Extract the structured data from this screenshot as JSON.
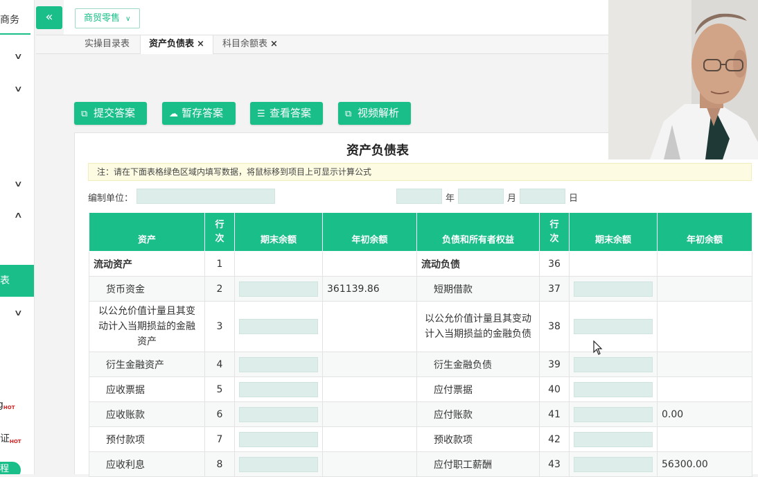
{
  "sidebar": {
    "brand": "商务",
    "active_item": "表",
    "hot_items": [
      {
        "label": "g",
        "badge": "HOT"
      },
      {
        "label": "证",
        "badge": "HOT"
      }
    ],
    "bottom_pill": "程"
  },
  "topbar": {
    "collapse_icon": "«",
    "store_select": "商贸零售"
  },
  "tabs": [
    {
      "label": "实操目录表",
      "active": false,
      "closable": false
    },
    {
      "label": "资产负债表",
      "active": true,
      "closable": true
    },
    {
      "label": "科目余额表",
      "active": false,
      "closable": true
    }
  ],
  "tab_close_icon": "×",
  "actions": [
    {
      "label": "提交答案",
      "icon": "external-link-icon"
    },
    {
      "label": "暂存答案",
      "icon": "cloud-upload-icon"
    },
    {
      "label": "查看答案",
      "icon": "database-icon"
    },
    {
      "label": "视频解析",
      "icon": "external-link-icon"
    }
  ],
  "sheet": {
    "title": "资产负债表",
    "notice": "注：请在下面表格绿色区域内填写数据，将鼠标移到项目上可显示计算公式",
    "unit_label": "编制单位：",
    "date_labels": {
      "year": "年",
      "month": "月",
      "day": "日"
    }
  },
  "table": {
    "headers": [
      "资产",
      "行次",
      "期末余额",
      "年初余额",
      "负债和所有者权益",
      "行次",
      "期末余额",
      "年初余额"
    ],
    "rows": [
      {
        "asset": "流动资产",
        "asset_no": "1",
        "asset_end": "",
        "asset_begin": "",
        "liab": "流动负债",
        "liab_no": "36",
        "liab_end": "",
        "liab_begin": ""
      },
      {
        "asset": "货币资金",
        "asset_no": "2",
        "asset_end": "",
        "asset_begin": "361139.86",
        "liab": "短期借款",
        "liab_no": "37",
        "liab_end": "",
        "liab_begin": ""
      },
      {
        "asset": "以公允价值计量且其变动计入当期损益的金融资产",
        "asset_no": "3",
        "asset_end": "",
        "asset_begin": "",
        "liab": "以公允价值计量且其变动计入当期损益的金融负债",
        "liab_no": "38",
        "liab_end": "",
        "liab_begin": ""
      },
      {
        "asset": "衍生金融资产",
        "asset_no": "4",
        "asset_end": "",
        "asset_begin": "",
        "liab": "衍生金融负债",
        "liab_no": "39",
        "liab_end": "",
        "liab_begin": ""
      },
      {
        "asset": "应收票据",
        "asset_no": "5",
        "asset_end": "",
        "asset_begin": "",
        "liab": "应付票据",
        "liab_no": "40",
        "liab_end": "",
        "liab_begin": ""
      },
      {
        "asset": "应收账款",
        "asset_no": "6",
        "asset_end": "",
        "asset_begin": "",
        "liab": "应付账款",
        "liab_no": "41",
        "liab_end": "",
        "liab_begin": "0.00"
      },
      {
        "asset": "预付款项",
        "asset_no": "7",
        "asset_end": "",
        "asset_begin": "",
        "liab": "预收款项",
        "liab_no": "42",
        "liab_end": "",
        "liab_begin": ""
      },
      {
        "asset": "应收利息",
        "asset_no": "8",
        "asset_end": "",
        "asset_begin": "",
        "liab": "应付职工薪酬",
        "liab_no": "43",
        "liab_end": "",
        "liab_begin": "56300.00"
      }
    ]
  }
}
